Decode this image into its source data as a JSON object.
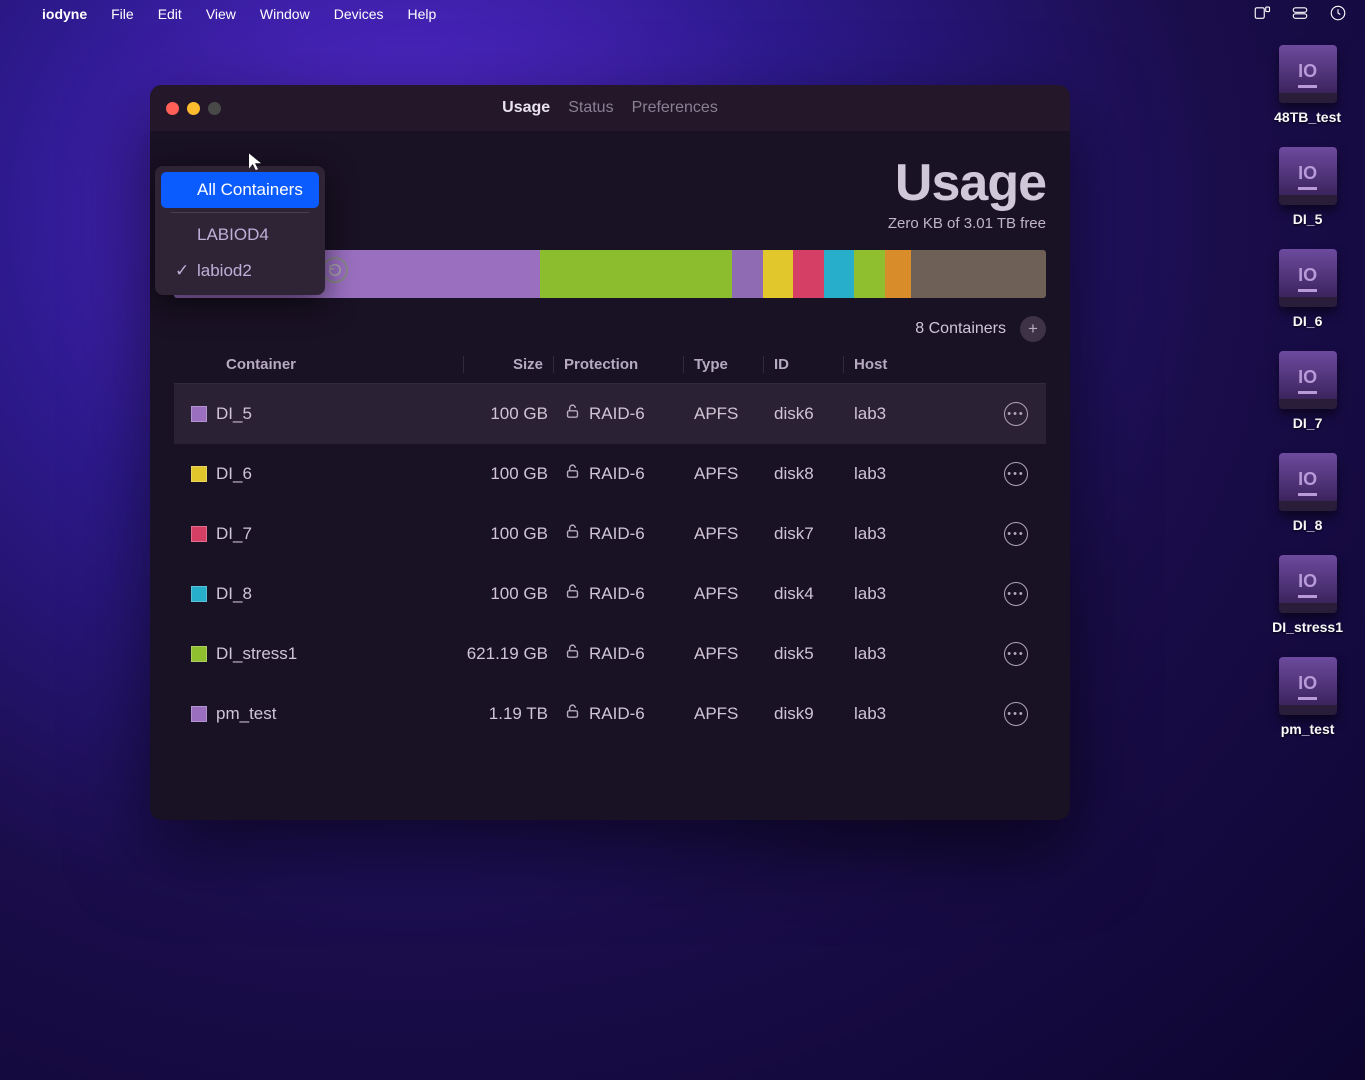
{
  "menubar": {
    "app": "iodyne",
    "items": [
      "File",
      "Edit",
      "View",
      "Window",
      "Devices",
      "Help"
    ]
  },
  "desktop": [
    {
      "label": "48TB_test"
    },
    {
      "label": "DI_5"
    },
    {
      "label": "DI_6"
    },
    {
      "label": "DI_7"
    },
    {
      "label": "DI_8"
    },
    {
      "label": "DI_stress1"
    },
    {
      "label": "pm_test"
    }
  ],
  "window": {
    "tabs": {
      "usage": "Usage",
      "status": "Status",
      "prefs": "Preferences"
    },
    "title": "Usage",
    "free_line": "Zero KB of 3.01 TB free",
    "dropdown": {
      "all": "All Containers",
      "items": [
        {
          "label": "LABIOD4",
          "checked": false
        },
        {
          "label": "labiod2",
          "checked": true
        }
      ]
    },
    "containers_count": "8 Containers",
    "usage_segments": [
      {
        "color": "#9a6fc0",
        "pct": 42
      },
      {
        "color": "#8bbd2e",
        "pct": 22
      },
      {
        "color": "#8f6bb3",
        "pct": 3.5
      },
      {
        "color": "#e2c72c",
        "pct": 3.5
      },
      {
        "color": "#d53f66",
        "pct": 3.5
      },
      {
        "color": "#27aecb",
        "pct": 3.5
      },
      {
        "color": "#8fbf2f",
        "pct": 3.5
      },
      {
        "color": "#d98c2a",
        "pct": 3
      },
      {
        "color": "#6e5f57",
        "pct": 15.5
      }
    ],
    "columns": {
      "container": "Container",
      "size": "Size",
      "protection": "Protection",
      "type": "Type",
      "id": "ID",
      "host": "Host"
    },
    "rows": [
      {
        "color": "#9a6fc0",
        "name": "DI_5",
        "size": "100 GB",
        "protection": "RAID-6",
        "type": "APFS",
        "id": "disk6",
        "host": "lab3"
      },
      {
        "color": "#e2c72c",
        "name": "DI_6",
        "size": "100 GB",
        "protection": "RAID-6",
        "type": "APFS",
        "id": "disk8",
        "host": "lab3"
      },
      {
        "color": "#d53f66",
        "name": "DI_7",
        "size": "100 GB",
        "protection": "RAID-6",
        "type": "APFS",
        "id": "disk7",
        "host": "lab3"
      },
      {
        "color": "#27aecb",
        "name": "DI_8",
        "size": "100 GB",
        "protection": "RAID-6",
        "type": "APFS",
        "id": "disk4",
        "host": "lab3"
      },
      {
        "color": "#8fbf2f",
        "name": "DI_stress1",
        "size": "621.19 GB",
        "protection": "RAID-6",
        "type": "APFS",
        "id": "disk5",
        "host": "lab3"
      },
      {
        "color": "#9a6fc0",
        "name": "pm_test",
        "size": "1.19 TB",
        "protection": "RAID-6",
        "type": "APFS",
        "id": "disk9",
        "host": "lab3"
      }
    ]
  }
}
